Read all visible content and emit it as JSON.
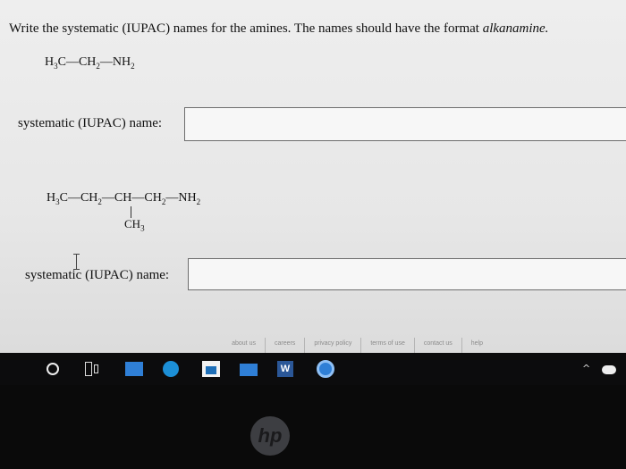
{
  "question": {
    "text_before": "Write the systematic (IUPAC) names for the amines. The names should have the format ",
    "format_word": "alkanamine."
  },
  "formula1": {
    "main": [
      "H",
      "3",
      "C—CH",
      "2",
      "—NH",
      "2"
    ]
  },
  "formula2": {
    "main": [
      "H",
      "3",
      "C—CH",
      "2",
      "—CH—CH",
      "2",
      "—NH",
      "2"
    ],
    "branch": [
      "CH",
      "3"
    ]
  },
  "label1": "systematic (IUPAC) name:",
  "label2": "systematic (IUPAC) name:",
  "answer1": {
    "value": ""
  },
  "answer2": {
    "value": ""
  },
  "footer": {
    "links": [
      "about us",
      "careers",
      "privacy policy",
      "terms of use",
      "contact us",
      "help"
    ]
  },
  "taskbar": {
    "icons": [
      "search-icon",
      "task-view-icon",
      "file-explorer-icon",
      "edge-icon",
      "store-icon",
      "mail-icon",
      "word-icon",
      "chrome-icon",
      "chevron-up-icon",
      "onedrive-icon"
    ],
    "word_letter": "W"
  },
  "bezel": {
    "logo_text": "hp"
  },
  "colors": {
    "page_bg": "#eeeeee",
    "taskbar_bg": "#0c0c0d",
    "accent_blue": "#2f7fd6"
  }
}
